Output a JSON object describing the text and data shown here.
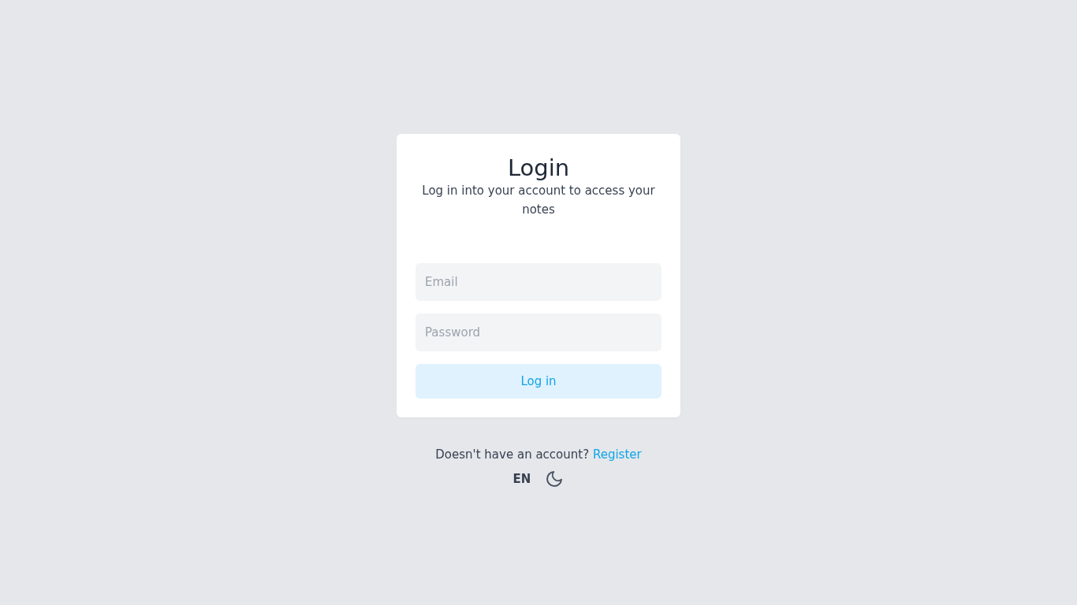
{
  "card": {
    "title": "Login",
    "subtitle": "Log in into your account to access your notes",
    "email_field": {
      "placeholder": "Email"
    },
    "password_field": {
      "placeholder": "Password"
    },
    "submit": "Log in"
  },
  "footer": {
    "prompt": "Doesn't have an account?",
    "link": "Register",
    "language": "EN"
  }
}
